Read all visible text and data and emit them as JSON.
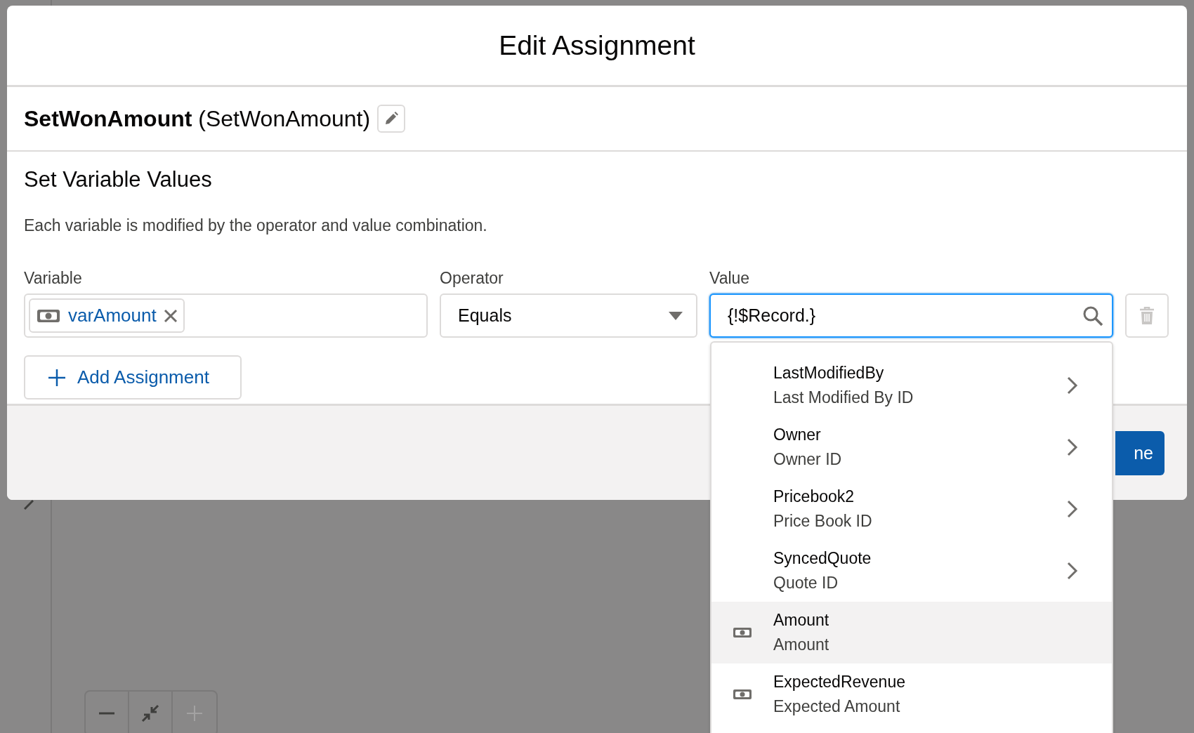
{
  "modal": {
    "title": "Edit Assignment"
  },
  "element": {
    "label": "SetWonAmount",
    "api_name": "(SetWonAmount)"
  },
  "section": {
    "heading": "Set Variable Values",
    "description": "Each variable is modified by the operator and value combination."
  },
  "assignment": {
    "variable_label": "Variable",
    "variable": "varAmount",
    "operator_label": "Operator",
    "operator": "Equals",
    "value_label": "Value",
    "value": "{!$Record.}",
    "delete_disabled": true
  },
  "add_button": "Add Assignment",
  "footer": {
    "done_button": "ne"
  },
  "dropdown": [
    {
      "kind": "reference",
      "name": "LastModifiedBy",
      "label": "Last Modified By ID",
      "highlighted": false
    },
    {
      "kind": "reference",
      "name": "Owner",
      "label": "Owner ID",
      "highlighted": false
    },
    {
      "kind": "reference",
      "name": "Pricebook2",
      "label": "Price Book ID",
      "highlighted": false
    },
    {
      "kind": "reference",
      "name": "SyncedQuote",
      "label": "Quote ID",
      "highlighted": false
    },
    {
      "kind": "currency",
      "name": "Amount",
      "label": "Amount",
      "highlighted": true
    },
    {
      "kind": "currency",
      "name": "ExpectedRevenue",
      "label": "Expected Amount",
      "highlighted": false
    }
  ],
  "zoom_controls": [
    {
      "kind": "minus",
      "disabled": false
    },
    {
      "kind": "fit",
      "disabled": false
    },
    {
      "kind": "plus",
      "disabled": true
    }
  ]
}
